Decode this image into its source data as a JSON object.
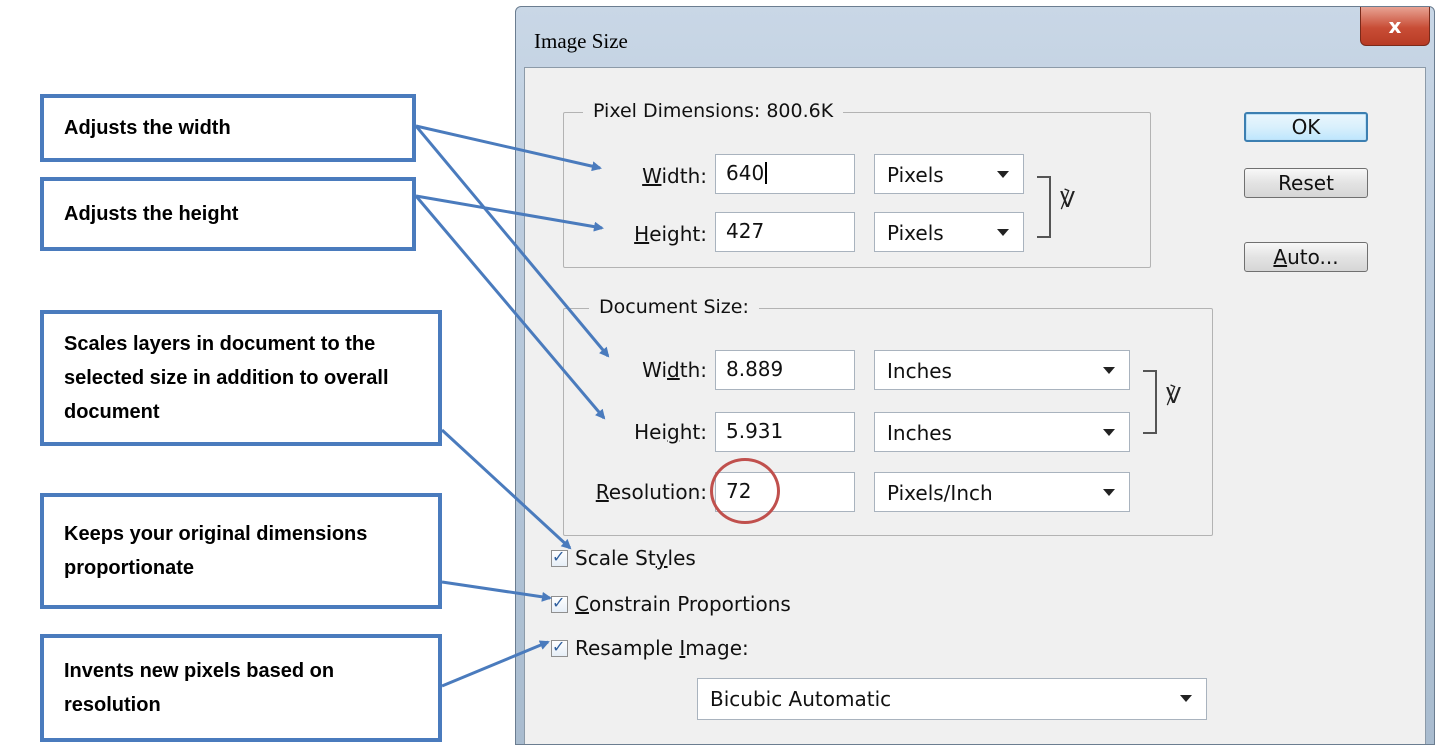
{
  "callouts": {
    "width": "Adjusts the width",
    "height": "Adjusts the height",
    "scale_styles": "Scales layers in document to the selected size in addition to overall document",
    "constrain": "Keeps your original dimensions proportionate",
    "resample": "Invents new pixels based on resolution"
  },
  "dialog": {
    "title": "Image Size",
    "close_glyph": "x",
    "pixel_dimensions": {
      "legend": "Pixel Dimensions:  800.6K",
      "width_label_pre": "",
      "width_label_u": "W",
      "width_label_post": "idth:",
      "width_value": "640",
      "width_unit": "Pixels",
      "height_label_pre": "",
      "height_label_u": "H",
      "height_label_post": "eight:",
      "height_value": "427",
      "height_unit": "Pixels"
    },
    "document_size": {
      "legend": "Document Size:",
      "width_label_pre": "Wi",
      "width_label_u": "d",
      "width_label_post": "th:",
      "width_value": "8.889",
      "width_unit": "Inches",
      "height_label_pre": "Hei",
      "height_label_u": "g",
      "height_label_post": "ht:",
      "height_value": "5.931",
      "height_unit": "Inches",
      "resolution_label_pre": "",
      "resolution_label_u": "R",
      "resolution_label_post": "esolution:",
      "resolution_value": "72",
      "resolution_unit": "Pixels/Inch"
    },
    "buttons": {
      "ok": "OK",
      "reset": "Reset",
      "auto_u": "A",
      "auto_rest": "uto..."
    },
    "checkboxes": {
      "scale_styles_pre": "Scale St",
      "scale_styles_u": "y",
      "scale_styles_post": "les",
      "scale_styles_checked": true,
      "constrain_pre": "",
      "constrain_u": "C",
      "constrain_post": "onstrain Proportions",
      "constrain_checked": true,
      "resample_pre": "Resample ",
      "resample_u": "I",
      "resample_post": "mage:",
      "resample_checked": true
    },
    "resample_method": "Bicubic Automatic",
    "check_glyph": "✓"
  },
  "colors": {
    "callout_border": "#4a7bbd",
    "highlight_circle": "#c0504d",
    "close_button": "#c84d36",
    "default_button_border": "#3c7fb1"
  },
  "icons": {
    "chain": "link-icon",
    "dropdown": "chevron-down-icon",
    "close": "close-icon"
  }
}
